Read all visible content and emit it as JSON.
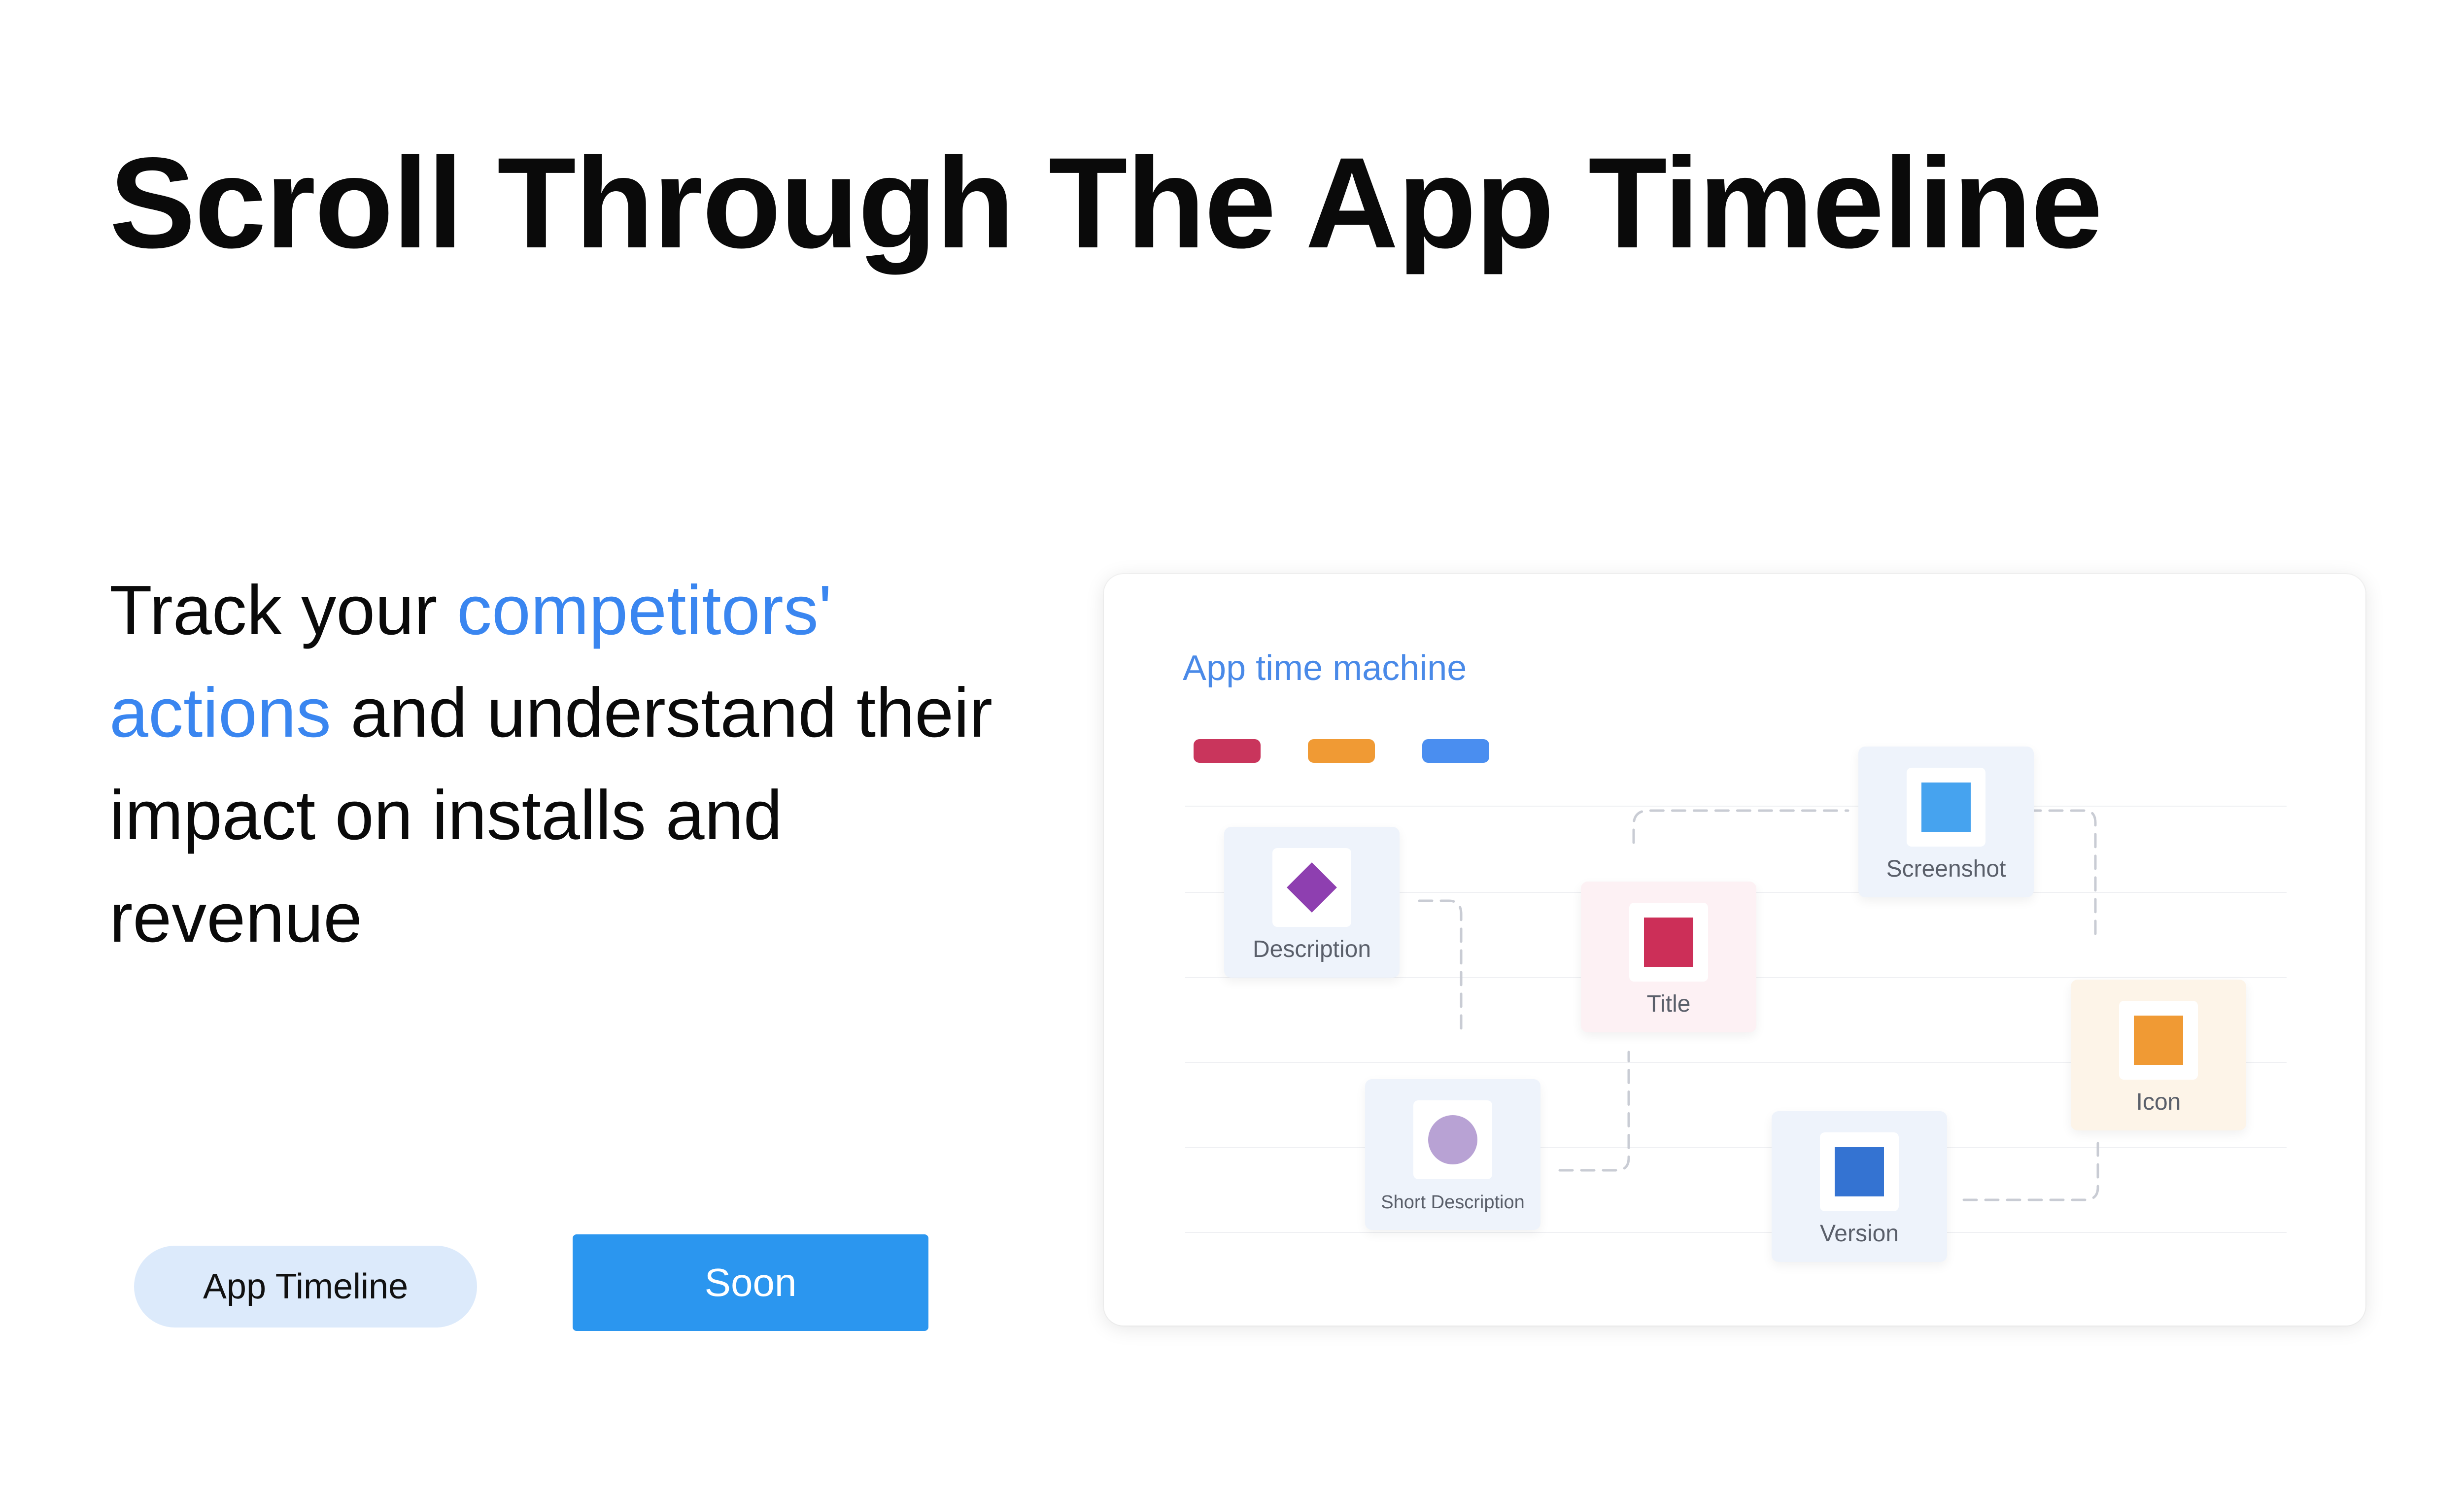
{
  "heading": "Scroll Through The App Timeline",
  "description": {
    "part1": "Track your ",
    "highlight": "competitors' actions",
    "part2": " and understand their impact on installs and revenue"
  },
  "buttons": {
    "timeline_label": "App Timeline",
    "soon_label": "Soon"
  },
  "widget": {
    "title": "App time machine",
    "legend_colors": [
      "#c9355c",
      "#f09a34",
      "#4a8ef0"
    ],
    "nodes": {
      "description": {
        "label": "Description",
        "icon": "diamond-icon",
        "color": "#8e3fb0"
      },
      "title": {
        "label": "Title",
        "icon": "square-icon",
        "color": "#cc2f58"
      },
      "screenshot": {
        "label": "Screenshot",
        "icon": "square-icon",
        "color": "#46a3ef"
      },
      "icon": {
        "label": "Icon",
        "icon": "square-icon",
        "color": "#f09a34"
      },
      "short_description": {
        "label": "Short Description",
        "icon": "circle-icon",
        "color": "#b8a2d4"
      },
      "version": {
        "label": "Version",
        "icon": "square-icon",
        "color": "#3473d2"
      }
    }
  },
  "colors": {
    "accent": "#3a86f0",
    "button_primary": "#2b96ef",
    "pill_bg": "#dceafb"
  }
}
